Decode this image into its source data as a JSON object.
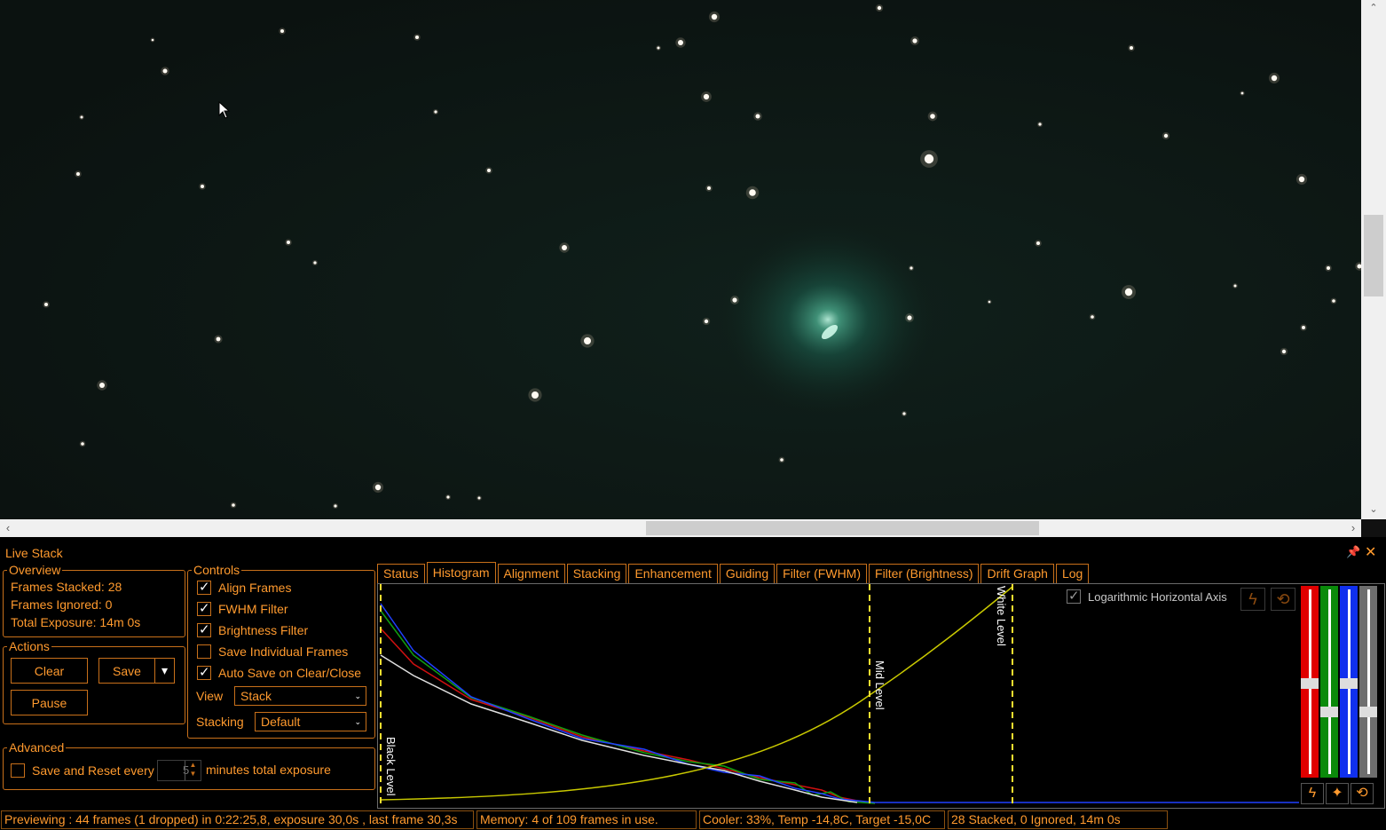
{
  "sky": {
    "stars": [
      [
        805,
        19,
        3.2
      ],
      [
        991,
        9,
        2.2
      ],
      [
        1031,
        46,
        2.6
      ],
      [
        767,
        48,
        3
      ],
      [
        470,
        42,
        2
      ],
      [
        318,
        35,
        2
      ],
      [
        186,
        80,
        2.5
      ],
      [
        1275,
        54,
        2
      ],
      [
        1436,
        88,
        3.2
      ],
      [
        796,
        109,
        3.1
      ],
      [
        854,
        131,
        2.5
      ],
      [
        1051,
        131,
        2.8
      ],
      [
        1314,
        153,
        2.2
      ],
      [
        1047,
        179,
        5.2
      ],
      [
        1467,
        202,
        3.2
      ],
      [
        848,
        217,
        3.8
      ],
      [
        799,
        212,
        2
      ],
      [
        88,
        196,
        2
      ],
      [
        228,
        210,
        2
      ],
      [
        551,
        192,
        2
      ],
      [
        1170,
        274,
        2
      ],
      [
        325,
        273,
        2
      ],
      [
        636,
        279,
        3
      ],
      [
        355,
        296,
        1.6
      ],
      [
        1497,
        302,
        2
      ],
      [
        1272,
        329,
        4.2
      ],
      [
        52,
        343,
        2
      ],
      [
        828,
        338,
        2.6
      ],
      [
        1027,
        302,
        1.6
      ],
      [
        1025,
        358,
        2.6
      ],
      [
        796,
        362,
        2.2
      ],
      [
        1231,
        357,
        1.8
      ],
      [
        1469,
        369,
        2
      ],
      [
        246,
        382,
        2.4
      ],
      [
        662,
        384,
        4
      ],
      [
        1447,
        396,
        2.2
      ],
      [
        115,
        434,
        3
      ],
      [
        603,
        445,
        4
      ],
      [
        93,
        500,
        1.8
      ],
      [
        881,
        518,
        1.8
      ],
      [
        1019,
        466,
        1.6
      ],
      [
        426,
        549,
        3.2
      ],
      [
        505,
        560,
        1.6
      ],
      [
        263,
        569,
        1.8
      ],
      [
        1503,
        339,
        1.8
      ],
      [
        1532,
        300,
        2.5
      ],
      [
        92,
        132,
        1.5
      ],
      [
        491,
        126,
        1.6
      ],
      [
        1172,
        140,
        1.6
      ],
      [
        1400,
        105,
        1.4
      ],
      [
        378,
        570,
        1.6
      ],
      [
        540,
        561,
        1.5
      ],
      [
        742,
        54,
        1.5
      ],
      [
        1392,
        322,
        1.5
      ],
      [
        1115,
        340,
        1.3
      ],
      [
        172,
        45,
        1.3
      ]
    ]
  },
  "panel": {
    "title": "Live Stack",
    "pin_icon": "📌",
    "close_icon": "✕",
    "overview": {
      "legend": "Overview",
      "frames_stacked": "Frames Stacked: 28",
      "frames_ignored": "Frames Ignored:  0",
      "total_exposure": "Total Exposure:   14m 0s"
    },
    "actions": {
      "legend": "Actions",
      "clear": "Clear",
      "save": "Save",
      "save_dropdown": "▾",
      "pause": "Pause"
    },
    "controls": {
      "legend": "Controls",
      "align_frames": "Align Frames",
      "fwhm_filter": "FWHM Filter",
      "brightness_filter": "Brightness Filter",
      "save_individual": "Save Individual Frames",
      "auto_save": "Auto Save on Clear/Close",
      "view_label": "View",
      "view_value": "Stack",
      "stacking_label": "Stacking",
      "stacking_value": "Default"
    },
    "advanced": {
      "legend": "Advanced",
      "save_reset_label": "Save and Reset every",
      "minutes_value": "5",
      "minutes_suffix": "minutes total exposure"
    },
    "tabs": [
      "Status",
      "Histogram",
      "Alignment",
      "Stacking",
      "Enhancement",
      "Guiding",
      "Filter (FWHM)",
      "Filter (Brightness)",
      "Drift Graph",
      "Log"
    ],
    "active_tab": "Histogram",
    "histogram": {
      "log_axis_label": "Logarithmic Horizontal Axis",
      "black_level": "Black Level",
      "mid_level": "Mid Level",
      "white_level": "White Level"
    }
  },
  "status": {
    "previewing": "Previewing : 44 frames (1 dropped) in 0:22:25,8, exposure 30,0s , last frame 30,3s",
    "memory": "Memory: 4 of 109 frames in use.",
    "cooler": "Cooler: 33%, Temp -14,8C, Target -15,0C",
    "stacked": "28 Stacked, 0 Ignored, 14m 0s"
  }
}
